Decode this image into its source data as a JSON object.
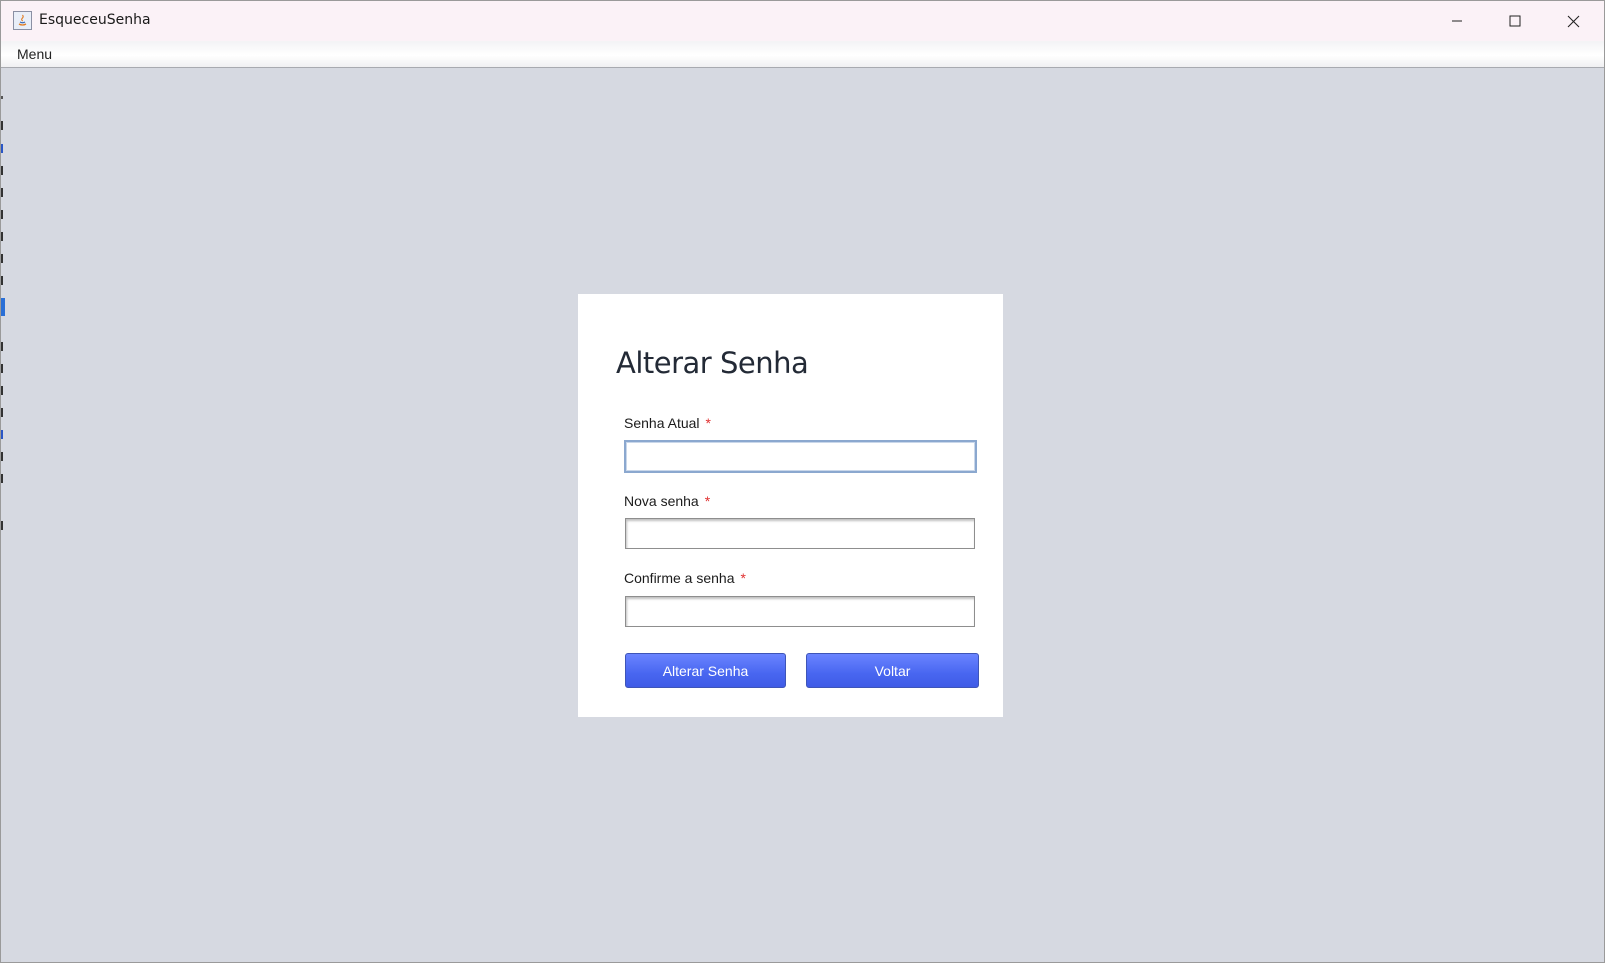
{
  "window": {
    "title": "EsqueceuSenha",
    "controls": {
      "minimize_icon": "minimize-icon",
      "maximize_icon": "maximize-icon",
      "close_icon": "close-icon"
    }
  },
  "menubar": {
    "items": [
      {
        "label": "Menu"
      }
    ]
  },
  "form": {
    "title": "Alterar Senha",
    "required_marker": "*",
    "fields": [
      {
        "label": "Senha Atual",
        "value": "",
        "focused": true
      },
      {
        "label": "Nova senha",
        "value": ""
      },
      {
        "label": "Confirme a senha",
        "value": ""
      }
    ],
    "buttons": {
      "submit_label": "Alterar Senha",
      "back_label": "Voltar"
    }
  },
  "colors": {
    "background": "#d6d9e1",
    "card": "#ffffff",
    "button": "#4866f0",
    "required": "#e03030",
    "focus_border": "#8ba8cf"
  }
}
